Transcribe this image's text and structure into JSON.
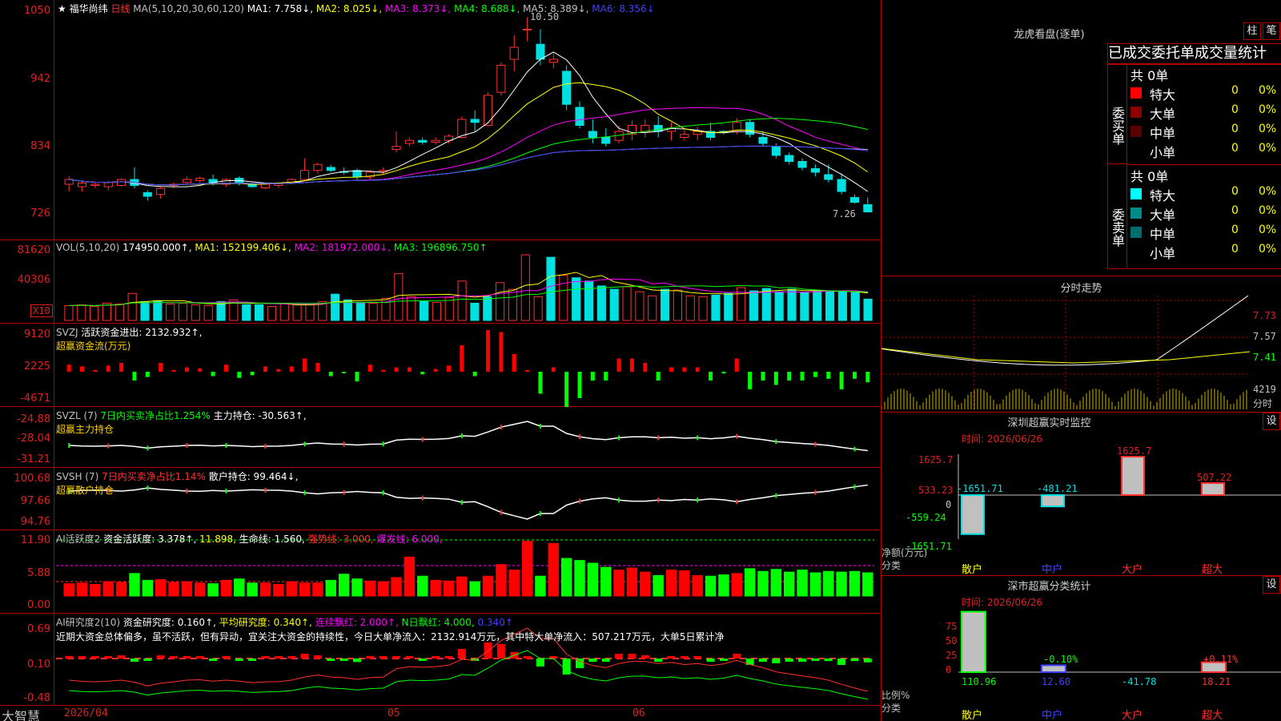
{
  "app": {
    "brand": "大智慧",
    "date_start": "2026/04",
    "month_05": "05",
    "month_06": "06"
  },
  "main": {
    "star": "★",
    "stock": "福华尚纬",
    "period": "日线",
    "ma_text": "MA(5,10,20,30,60,120)",
    "ma1": "MA1: 7.758↓,",
    "ma2": "MA2: 8.025↓,",
    "ma3": "MA3: 8.373↓,",
    "ma4": "MA4: 8.688↓,",
    "ma5": "MA5: 8.389↓,",
    "ma6": "MA6: 8.356↓",
    "high_label": "10.50",
    "low_label": "7.26",
    "yticks": [
      "1050",
      "942",
      "834",
      "726"
    ]
  },
  "vol": {
    "label": "VOL(5,10,20)",
    "value": "174950.000↑,",
    "ma1": "MA1: 152199.406↓,",
    "ma2": "MA2: 181972.000↓,",
    "ma3": "MA3: 196896.750↑",
    "yticks": [
      "81620",
      "40306"
    ],
    "unit": "X10"
  },
  "svzj": {
    "label": "SVZJ",
    "line1": "活跃资金进出: 2132.932↑,",
    "line2": "超赢资金流(万元)",
    "yticks": [
      "9120",
      "2225",
      "-4671"
    ]
  },
  "svzl": {
    "label": "SVZL (7)",
    "a": "7日内买卖净占比1.254%",
    "b": "主力持仓: -30.563↑,",
    "line2": "超赢主力持仓",
    "yticks": [
      "-24.88",
      "-28.04",
      "-31.21"
    ]
  },
  "svsh": {
    "label": "SVSH (7)",
    "a": "7日内买卖净占比1.14%",
    "b": "散户持仓: 99.464↓,",
    "line2": "超赢散户持仓",
    "yticks": [
      "100.68",
      "97.66",
      "94.76"
    ]
  },
  "ai1": {
    "label": "AI活跃度2",
    "a": "资金活跃度: 3.378↑,",
    "b": "11.898,",
    "c": "生命线: 1.560,",
    "d": "强势线: 3.000,",
    "e": "爆发线: 6.000,",
    "yticks": [
      "11.90",
      "5.88",
      "0.00"
    ]
  },
  "ai2": {
    "label": "AI研究度2(10)",
    "a": "资金研究度: 0.160↑,",
    "b": "平均研究度: 0.340↑,",
    "c": "连续飘红: 2.000↑,",
    "d": "N日飘红: 4.000,",
    "e": "0.340↑",
    "comment": "近期大资金总体偏多，虽不活跃，但有异动，宜关注大资金的持续性，今日大单净流入：2132.914万元，其中特大单净流入：507.217万元，大单5日累计净",
    "yticks": [
      "0.69",
      "0.10",
      "-0.48"
    ]
  },
  "lhb": {
    "title": "龙虎看盘(逐单)",
    "btn1": "柱",
    "btn2": "笔",
    "tabs": "已成交委托单成交量统计",
    "buy_side": "委买单",
    "sell_side": "委卖单",
    "buy_total": "共 0单",
    "sell_total": "共 0单",
    "buy_rows": [
      {
        "name": "特大",
        "count": "0",
        "pct": "0%",
        "color": "#ff0000"
      },
      {
        "name": "大单",
        "count": "0",
        "pct": "0%",
        "color": "#8b0000"
      },
      {
        "name": "中单",
        "count": "0",
        "pct": "0%",
        "color": "#5a0000"
      },
      {
        "name": "小单",
        "count": "0",
        "pct": "0%",
        "color": "#000000"
      }
    ],
    "sell_rows": [
      {
        "name": "特大",
        "count": "0",
        "pct": "0%",
        "color": "#00ffff"
      },
      {
        "name": "大单",
        "count": "0",
        "pct": "0%",
        "color": "#008b8b"
      },
      {
        "name": "中单",
        "count": "0",
        "pct": "0%",
        "color": "#006e6e"
      },
      {
        "name": "小单",
        "count": "0",
        "pct": "0%",
        "color": "#000000"
      }
    ]
  },
  "fenshi": {
    "title": "分时走势",
    "p1": "7.73",
    "p2": "7.57",
    "p3": "7.41",
    "vol": "4219",
    "unit": "分时"
  },
  "szjk": {
    "title": "深圳超赢实时监控",
    "btn": "设",
    "time": "时间: 2026/06/26",
    "yticks": [
      "1625.7",
      "533.23",
      "0",
      "-559.24",
      "-1651.71"
    ],
    "unit": "净额(万元)",
    "cat_label": "分类"
  },
  "szfl": {
    "title": "深市超赢分类统计",
    "btn": "设",
    "time": "时间: 2026/06/26",
    "yticks": [
      "75",
      "50",
      "25",
      "0"
    ],
    "unit": "比例%",
    "cat_label": "分类"
  },
  "chart_data": [
    {
      "type": "candlestick",
      "title": "福华尚纬 日线",
      "ylim": [
        7.0,
        10.6
      ],
      "ohlc": [
        [
          7.72,
          7.8,
          7.6,
          7.85
        ],
        [
          7.68,
          7.74,
          7.6,
          7.76
        ],
        [
          7.7,
          7.72,
          7.66,
          7.75
        ],
        [
          7.68,
          7.75,
          7.62,
          7.78
        ],
        [
          7.7,
          7.8,
          7.68,
          7.82
        ],
        [
          7.8,
          7.7,
          7.65,
          8.0
        ],
        [
          7.58,
          7.52,
          7.45,
          7.62
        ],
        [
          7.55,
          7.65,
          7.48,
          7.68
        ],
        [
          7.7,
          7.72,
          7.65,
          7.75
        ],
        [
          7.75,
          7.8,
          7.7,
          7.85
        ],
        [
          7.78,
          7.82,
          7.75,
          7.85
        ],
        [
          7.8,
          7.75,
          7.7,
          7.88
        ],
        [
          7.72,
          7.8,
          7.68,
          7.82
        ],
        [
          7.82,
          7.75,
          7.7,
          7.85
        ],
        [
          7.72,
          7.68,
          7.66,
          7.75
        ],
        [
          7.66,
          7.72,
          7.64,
          7.74
        ],
        [
          7.7,
          7.73,
          7.66,
          7.75
        ],
        [
          7.74,
          7.8,
          7.72,
          7.82
        ],
        [
          7.8,
          7.95,
          7.78,
          8.15
        ],
        [
          7.95,
          8.05,
          7.9,
          8.08
        ],
        [
          8.0,
          7.95,
          7.92,
          8.04
        ],
        [
          7.93,
          7.92,
          7.88,
          8.0
        ],
        [
          7.95,
          7.84,
          7.8,
          7.98
        ],
        [
          7.84,
          7.92,
          7.8,
          7.95
        ],
        [
          7.93,
          7.95,
          7.88,
          8.0
        ],
        [
          8.3,
          8.35,
          8.25,
          8.6
        ],
        [
          8.4,
          8.45,
          8.35,
          8.5
        ],
        [
          8.45,
          8.42,
          8.38,
          8.5
        ],
        [
          8.42,
          8.45,
          8.38,
          8.5
        ],
        [
          8.45,
          8.52,
          8.4,
          8.55
        ],
        [
          8.5,
          8.8,
          8.48,
          8.85
        ],
        [
          8.8,
          8.75,
          8.6,
          8.95
        ],
        [
          8.7,
          9.2,
          8.68,
          9.25
        ],
        [
          9.25,
          9.7,
          9.2,
          9.75
        ],
        [
          9.8,
          10.0,
          9.6,
          10.2
        ],
        [
          10.3,
          10.3,
          10.1,
          10.5
        ],
        [
          10.05,
          9.8,
          9.7,
          10.3
        ],
        [
          9.75,
          9.8,
          9.65,
          9.9
        ],
        [
          9.6,
          9.05,
          8.95,
          9.7
        ],
        [
          9.0,
          8.7,
          8.65,
          9.1
        ],
        [
          8.6,
          8.5,
          8.4,
          8.8
        ],
        [
          8.5,
          8.4,
          8.35,
          8.65
        ],
        [
          8.45,
          8.6,
          8.4,
          8.7
        ],
        [
          8.55,
          8.7,
          8.45,
          8.78
        ],
        [
          8.6,
          8.7,
          8.5,
          8.8
        ],
        [
          8.7,
          8.6,
          8.5,
          8.85
        ],
        [
          8.6,
          8.65,
          8.45,
          8.75
        ],
        [
          8.5,
          8.55,
          8.45,
          8.62
        ],
        [
          8.55,
          8.6,
          8.45,
          8.68
        ],
        [
          8.6,
          8.5,
          8.45,
          8.75
        ],
        [
          8.6,
          8.58,
          8.55,
          8.62
        ],
        [
          8.6,
          8.75,
          8.55,
          8.82
        ],
        [
          8.75,
          8.55,
          8.5,
          8.8
        ],
        [
          8.5,
          8.4,
          8.35,
          8.6
        ],
        [
          8.35,
          8.2,
          8.15,
          8.4
        ],
        [
          8.2,
          8.1,
          8.05,
          8.25
        ],
        [
          8.1,
          8.0,
          7.95,
          8.15
        ],
        [
          7.98,
          7.92,
          7.85,
          8.05
        ],
        [
          7.88,
          7.8,
          7.75,
          8.05
        ],
        [
          7.8,
          7.6,
          7.55,
          7.9
        ],
        [
          7.5,
          7.42,
          7.4,
          7.55
        ],
        [
          7.38,
          7.26,
          7.26,
          7.5
        ]
      ]
    },
    {
      "type": "bar",
      "title": "VOL(5,10,20)",
      "values": [
        18000,
        19000,
        17000,
        21000,
        20000,
        33000,
        23000,
        24000,
        20000,
        21000,
        19000,
        18000,
        23000,
        25000,
        19000,
        19000,
        17000,
        21000,
        19000,
        19000,
        23000,
        32000,
        25000,
        22000,
        21000,
        27000,
        57000,
        29000,
        23000,
        22000,
        28000,
        48000,
        21000,
        29000,
        46000,
        38000,
        80000,
        29000,
        77000,
        55000,
        52000,
        48000,
        42000,
        38000,
        41000,
        35000,
        30000,
        38000,
        37000,
        30000,
        29000,
        31000,
        33000,
        40000,
        36000,
        39000,
        35000,
        38000,
        34000,
        36000,
        35000,
        36000,
        34000,
        26000
      ],
      "ylim": [
        0,
        82000
      ]
    }
  ]
}
